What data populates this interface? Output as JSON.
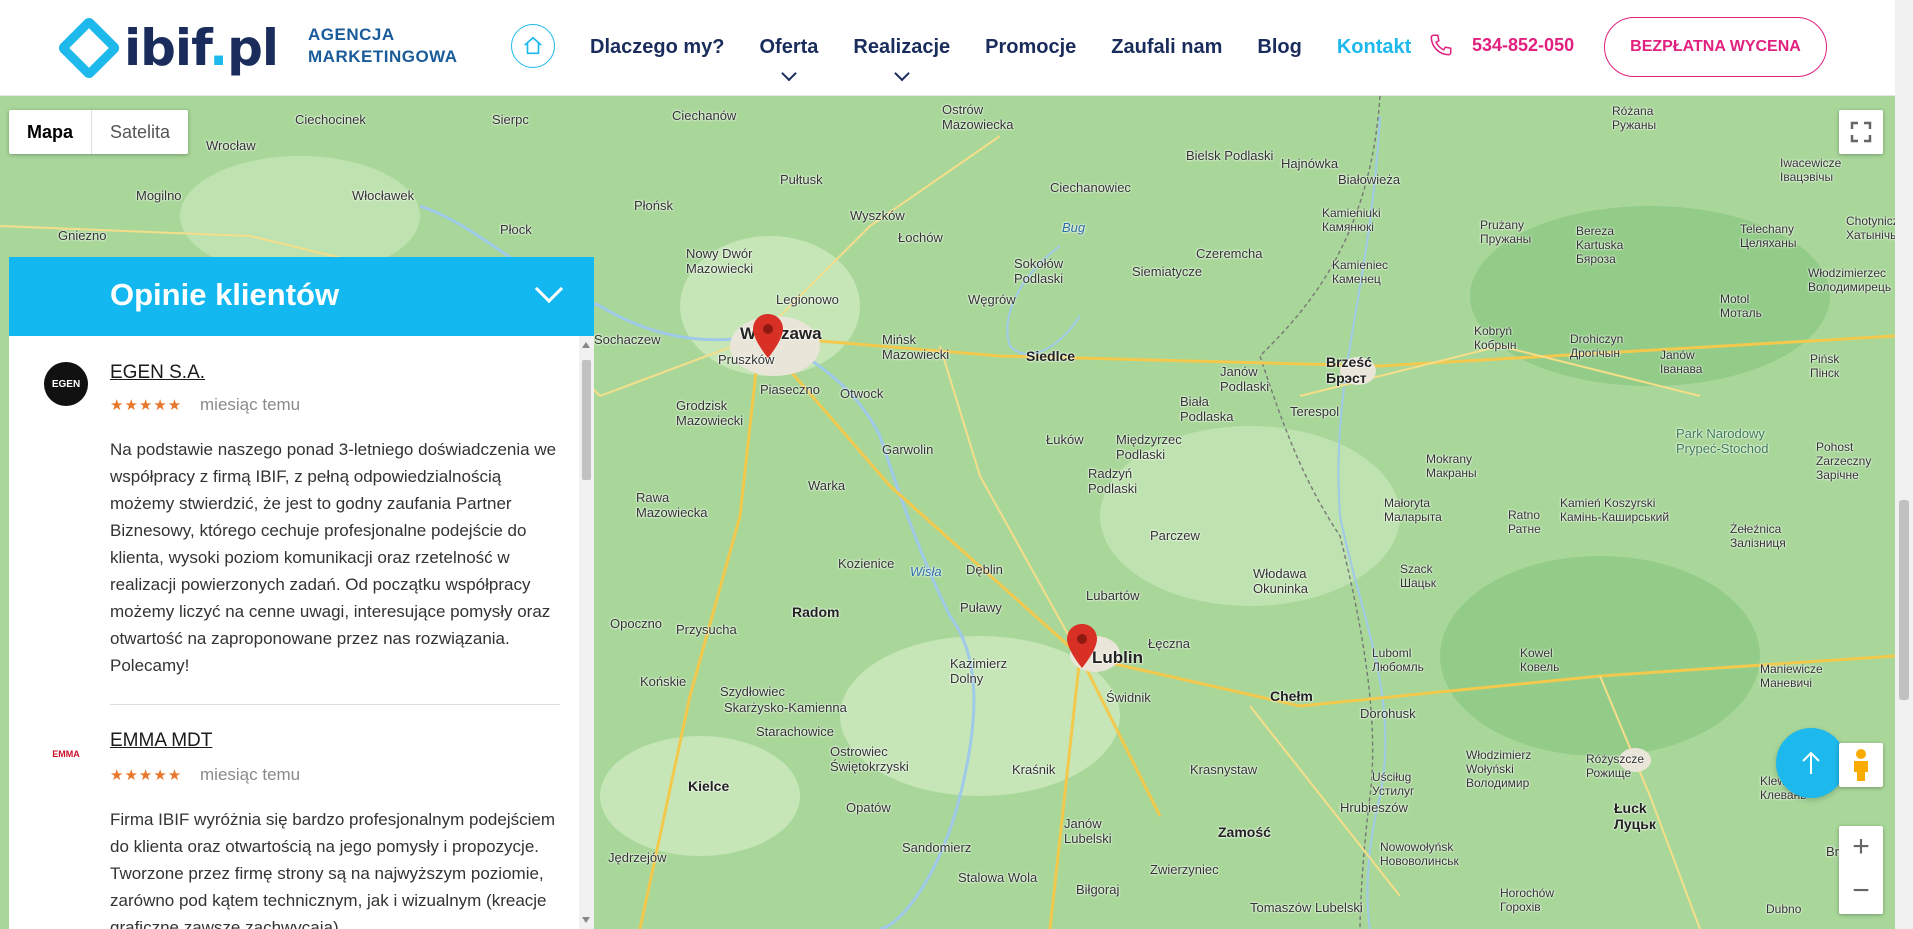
{
  "header": {
    "logo_main": "ibif",
    "logo_dot": ".",
    "logo_tld": "pl",
    "agency_line1": "AGENCJA",
    "agency_line2": "MARKETINGOWA",
    "home_icon": "home-icon",
    "nav": [
      {
        "label": "Dlaczego my?",
        "dropdown": false,
        "active": false
      },
      {
        "label": "Oferta",
        "dropdown": true,
        "active": false
      },
      {
        "label": "Realizacje",
        "dropdown": true,
        "active": false
      },
      {
        "label": "Promocje",
        "dropdown": false,
        "active": false
      },
      {
        "label": "Zaufali nam",
        "dropdown": false,
        "active": false
      },
      {
        "label": "Blog",
        "dropdown": false,
        "active": false
      },
      {
        "label": "Kontakt",
        "dropdown": false,
        "active": true
      }
    ],
    "phone_icon": "phone-icon",
    "phone": "534-852-050",
    "cta": "BEZPŁATNA WYCENA"
  },
  "map": {
    "type_map": "Mapa",
    "type_satellite": "Satelita",
    "zoom_in": "+",
    "zoom_out": "−",
    "labels": [
      {
        "text": "Ciechanów"
      },
      {
        "text": "Ostrów Mazowiecka"
      },
      {
        "text": "Bielsk Podlaski"
      },
      {
        "text": "Hajnówka"
      },
      {
        "text": "Białowieża"
      },
      {
        "text": "Ciechocinek"
      },
      {
        "text": "Sierpc"
      },
      {
        "text": "Włocławek"
      },
      {
        "text": "Płock"
      },
      {
        "text": "Pułtusk"
      },
      {
        "text": "Płońsk"
      },
      {
        "text": "Ciechanowiec"
      },
      {
        "text": "Wyszków"
      },
      {
        "text": "Łochów"
      },
      {
        "text": "Nowy Dwór Mazowiecki"
      },
      {
        "text": "Legionowo"
      },
      {
        "text": "Sokołów Podlaski"
      },
      {
        "text": "Czeremcha"
      },
      {
        "text": "Siemiatycze"
      },
      {
        "text": "Kamieniuki Камянюкі"
      },
      {
        "text": "Kamieniec Каменец"
      },
      {
        "text": "Węgrów"
      },
      {
        "text": "Warszawa"
      },
      {
        "text": "Pruszków"
      },
      {
        "text": "Mińsk Mazowiecki"
      },
      {
        "text": "Siedlce"
      },
      {
        "text": "Brześć Брэст"
      },
      {
        "text": "Piaseczno"
      },
      {
        "text": "Otwock"
      },
      {
        "text": "Janów Podlaski"
      },
      {
        "text": "Biała Podlaska"
      },
      {
        "text": "Terespol"
      },
      {
        "text": "Grodzisk Mazowiecki"
      },
      {
        "text": "Garwolin"
      },
      {
        "text": "Łuków"
      },
      {
        "text": "Międzyrzec Podlaski"
      },
      {
        "text": "Radzyń Podlaski"
      },
      {
        "text": "Rawa Mazowiecka"
      },
      {
        "text": "Warka"
      },
      {
        "text": "Parczew"
      },
      {
        "text": "Kozienice"
      },
      {
        "text": "Dęblin"
      },
      {
        "text": "Włodawa Okuninka"
      },
      {
        "text": "Lubartów"
      },
      {
        "text": "Radom"
      },
      {
        "text": "Puławy"
      },
      {
        "text": "Opoczno"
      },
      {
        "text": "Przysucha"
      },
      {
        "text": "Kazimierz Dolny"
      },
      {
        "text": "Lublin"
      },
      {
        "text": "Łęczna"
      },
      {
        "text": "Świdnik"
      },
      {
        "text": "Chełm"
      },
      {
        "text": "Końskie"
      },
      {
        "text": "Szydłowiec"
      },
      {
        "text": "Skarżysko-Kamienna"
      },
      {
        "text": "Starachowice"
      },
      {
        "text": "Ostrowiec Świętokrzyski"
      },
      {
        "text": "Kraśnik"
      },
      {
        "text": "Krasnystaw"
      },
      {
        "text": "Kielce"
      },
      {
        "text": "Opatów"
      },
      {
        "text": "Hrubieszów"
      },
      {
        "text": "Zamość"
      },
      {
        "text": "Janów Lubelski"
      },
      {
        "text": "Sandomierz"
      },
      {
        "text": "Jędrzejów"
      },
      {
        "text": "Stalowa Wola"
      },
      {
        "text": "Biłgoraj"
      },
      {
        "text": "Zwierzyniec"
      },
      {
        "text": "Tomaszów Lubelski"
      },
      {
        "text": "Dorohusk"
      },
      {
        "text": "Luboml Любомль"
      },
      {
        "text": "Kowel Ковель"
      },
      {
        "text": "Łuck Луцьк"
      },
      {
        "text": "Brest"
      },
      {
        "text": "Park Narodowy Prypeć-Stochod"
      },
      {
        "text": "Szack Шацьк"
      },
      {
        "text": "Wrocław"
      },
      {
        "text": "Mogilno"
      },
      {
        "text": "Gniezno"
      },
      {
        "text": "Sochaczew"
      },
      {
        "text": "Kobryń Кобрын"
      },
      {
        "text": "Drohiczyn Дрогічын"
      },
      {
        "text": "Janów Іванава"
      },
      {
        "text": "Pińsk Пінск"
      },
      {
        "text": "Motol Моталь"
      },
      {
        "text": "Telechany Целяханы"
      },
      {
        "text": "Bereza Kartuska Бяроза"
      },
      {
        "text": "Prużany Пружаны"
      },
      {
        "text": "Różana Ружаны"
      },
      {
        "text": "Iwacewicze Івацэвічы"
      },
      {
        "text": "Chotynicze Хатынічы"
      },
      {
        "text": "Mokrany Макраны"
      },
      {
        "text": "Małoryta Маларыта"
      },
      {
        "text": "Ratno Ратне"
      },
      {
        "text": "Kamień Koszyrski Камінь-Каширський"
      },
      {
        "text": "Żełeźnica Залізниця"
      },
      {
        "text": "Pohost Zarzeczny Зарічне"
      },
      {
        "text": "Maniewicze Маневичі"
      },
      {
        "text": "Różyszcze Рожище"
      },
      {
        "text": "Włodzimierz Wołyński Володимир"
      },
      {
        "text": "Uściług Устилуг"
      },
      {
        "text": "Nowowołyńsk Нововолинськ"
      },
      {
        "text": "Horochów Горохів"
      },
      {
        "text": "Klewań Клевань"
      },
      {
        "text": "Włodzimierzec Володимирець"
      },
      {
        "text": "Dubno"
      },
      {
        "text": "Wisła"
      },
      {
        "text": "Bug"
      }
    ]
  },
  "reviews": {
    "title": "Opinie klientów",
    "items": [
      {
        "name": "EGEN S.A.",
        "avatar_text": "EGEN",
        "stars": "★★★★★",
        "time": "miesiąc temu",
        "text": "Na podstawie naszego ponad 3-letniego doświadczenia we współpracy z firmą IBIF, z pełną odpowiedzialnością możemy stwierdzić, że jest to godny zaufania Partner Biznesowy, którego cechuje profesjonalne podejście do klienta, wysoki poziom komunikacji oraz rzetelność w realizacji powierzonych zadań. Od początku współpracy możemy liczyć na cenne uwagi, interesujące pomysły oraz otwartość na zaproponowane przez nas rozwiązania. Polecamy!"
      },
      {
        "name": "EMMA MDT",
        "avatar_text": "EMMA",
        "stars": "★★★★★",
        "time": "miesiąc temu",
        "text": "Firma IBIF wyróżnia się bardzo profesjonalnym podejściem do klienta oraz otwartością na jego pomysły i propozycje. Tworzone przez firmę strony są na najwyższym poziomie, zarówno pod kątem technicznym, jak i wizualnym (kreacje graficzne zawsze zachwycają)."
      }
    ]
  },
  "colors": {
    "accent": "#1db9ec",
    "navy": "#1a2c5b",
    "pink": "#e0217f",
    "map_green": "#a9d79a",
    "pin_red": "#d93025"
  }
}
